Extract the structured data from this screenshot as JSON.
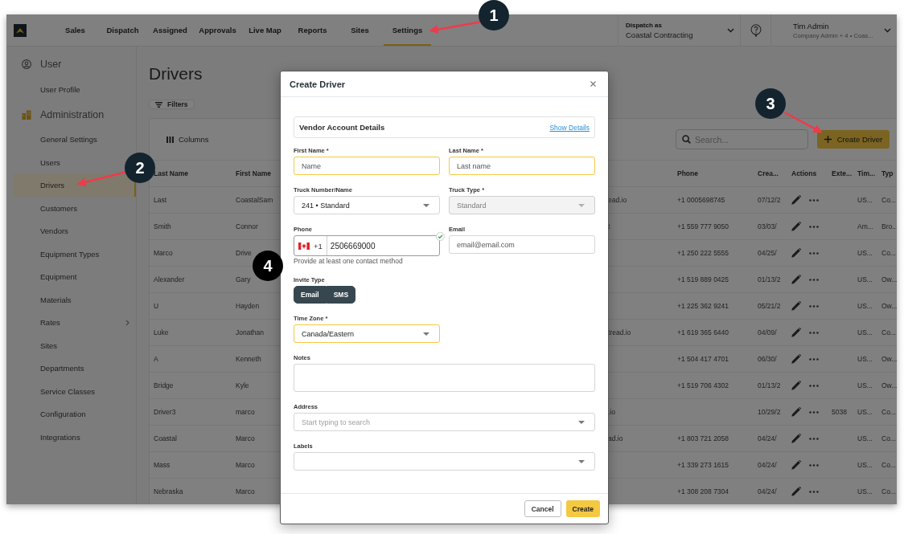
{
  "top_bar": {
    "nav": [
      {
        "label": "Sales",
        "selected": false
      },
      {
        "label": "Dispatch",
        "selected": false
      },
      {
        "label": "Assigned",
        "selected": false
      },
      {
        "label": "Approvals",
        "selected": false
      },
      {
        "label": "Live Map",
        "selected": false
      },
      {
        "label": "Reports",
        "selected": false
      },
      {
        "label": "Sites",
        "selected": false
      },
      {
        "label": "Settings",
        "selected": true
      }
    ],
    "dispatch_as": {
      "label": "Dispatch as",
      "value": "Coastal Contracting"
    },
    "user": {
      "name": "Tim Admin",
      "role": "Company Admin + 4 • Coas..."
    }
  },
  "sidebar": {
    "sections": [
      {
        "title": "User",
        "kind": "user",
        "items": [
          {
            "label": "User Profile",
            "selected": false,
            "has_submenu": false
          }
        ]
      },
      {
        "title": "Administration",
        "kind": "admin",
        "items": [
          {
            "label": "General Settings",
            "selected": false,
            "has_submenu": false
          },
          {
            "label": "Users",
            "selected": false,
            "has_submenu": false
          },
          {
            "label": "Drivers",
            "selected": true,
            "has_submenu": false
          },
          {
            "label": "Customers",
            "selected": false,
            "has_submenu": false
          },
          {
            "label": "Vendors",
            "selected": false,
            "has_submenu": false
          },
          {
            "label": "Equipment Types",
            "selected": false,
            "has_submenu": false
          },
          {
            "label": "Equipment",
            "selected": false,
            "has_submenu": false
          },
          {
            "label": "Materials",
            "selected": false,
            "has_submenu": false
          },
          {
            "label": "Rates",
            "selected": false,
            "has_submenu": true
          },
          {
            "label": "Sites",
            "selected": false,
            "has_submenu": false
          },
          {
            "label": "Departments",
            "selected": false,
            "has_submenu": false
          },
          {
            "label": "Service Classes",
            "selected": false,
            "has_submenu": false
          },
          {
            "label": "Configuration",
            "selected": false,
            "has_submenu": false
          },
          {
            "label": "Integrations",
            "selected": false,
            "has_submenu": false
          }
        ]
      }
    ]
  },
  "page": {
    "title": "Drivers",
    "filters_button": "Filters",
    "columns_button": "Columns",
    "search": {
      "placeholder": "Search..."
    },
    "create_button": "Create Driver"
  },
  "table": {
    "columns": [
      {
        "label": "Last Name",
        "kind": "text"
      },
      {
        "label": "First Name",
        "kind": "text"
      },
      {
        "kind": "text"
      },
      {
        "label": "Phone",
        "kind": "text"
      },
      {
        "label": "Crea...",
        "kind": "text"
      },
      {
        "label": "Actions",
        "kind": "actions"
      },
      {
        "label": "Exte...",
        "kind": "text"
      },
      {
        "label": "Tim...",
        "kind": "text"
      },
      {
        "label": "Typ",
        "kind": "text"
      }
    ],
    "rows": [
      {
        "cells": [
          "Last",
          "CoastalSam",
          "ead.io",
          "+1 0005698745",
          "07/12/2",
          null,
          null,
          "US...",
          "Co..."
        ]
      },
      {
        "cells": [
          "Smith",
          "Connor",
          "t",
          "+1 559 777 9050",
          "03/03/",
          null,
          null,
          "Am...",
          "Bro..."
        ]
      },
      {
        "cells": [
          "Marco",
          "Drive",
          null,
          "+1 250 222 5555",
          "04/25/",
          null,
          null,
          "US...",
          "Co..."
        ]
      },
      {
        "cells": [
          "Alexander",
          "Gary",
          null,
          "+1 519 889 0425",
          "01/13/2",
          null,
          null,
          "US...",
          "Ow..."
        ]
      },
      {
        "cells": [
          "U",
          "Hayden",
          null,
          "+1 225 362 9241",
          "05/21/2",
          null,
          null,
          "US...",
          "Ow..."
        ]
      },
      {
        "cells": [
          "Luke",
          "Jonathan",
          "tread.io",
          "+1 619 365 6440",
          "04/09/",
          null,
          null,
          "US...",
          "Co..."
        ]
      },
      {
        "cells": [
          "A",
          "Kenneth",
          null,
          "+1 504 417 4701",
          "06/30/",
          null,
          null,
          "US...",
          "Ow..."
        ]
      },
      {
        "cells": [
          "Bridge",
          "Kyle",
          null,
          "+1 519 706 4302",
          "01/13/2",
          null,
          null,
          "US...",
          "Ow..."
        ]
      },
      {
        "cells": [
          "Driver3",
          "marco",
          ".io",
          null,
          "10/29/2",
          null,
          "5038",
          "US...",
          "Co..."
        ]
      },
      {
        "cells": [
          "Coastal",
          "Marco",
          "ad.io",
          "+1 803 721 2058",
          "04/24/",
          null,
          null,
          "US...",
          "Co..."
        ]
      },
      {
        "cells": [
          "Mass",
          "Marco",
          null,
          "+1 339 273 1615",
          "04/24/",
          null,
          null,
          "US...",
          "Co..."
        ]
      },
      {
        "cells": [
          "Nebraska",
          "Marco",
          null,
          "+1 308 208 7304",
          "04/24/",
          null,
          null,
          "US...",
          "Co..."
        ]
      }
    ]
  },
  "dialog": {
    "title": "Create Driver",
    "account_card": {
      "title": "Vendor Account Details",
      "link": "Show Details"
    },
    "form_rows": [
      [
        {
          "kind": "text",
          "label": "First Name *",
          "placeholder": "Name",
          "highlighted": true,
          "disabled": false
        },
        {
          "kind": "text",
          "label": "Last Name *",
          "placeholder": "Last name",
          "highlighted": true,
          "disabled": false
        }
      ],
      [
        {
          "kind": "select",
          "label": "Truck Number/Name",
          "value": "241 • Standard",
          "highlighted": false,
          "disabled": false
        },
        {
          "kind": "select",
          "label": "Truck Type *",
          "value": "Standard",
          "highlighted": false,
          "disabled": true
        }
      ],
      [
        {
          "kind": "phone",
          "label": "Phone",
          "country_code": "+1",
          "value": "2506669000",
          "valid": true,
          "helper": "Provide at least one contact method",
          "highlighted": false,
          "disabled": false
        },
        {
          "kind": "text",
          "label": "Email",
          "placeholder": "email@email.com",
          "highlighted": false,
          "disabled": false
        }
      ],
      [
        {
          "kind": "toggle",
          "label": "Invite Type",
          "options": [
            {
              "label": "Email",
              "selected": true
            },
            {
              "label": "SMS",
              "selected": true
            }
          ]
        }
      ],
      [
        {
          "kind": "select",
          "label": "Time Zone *",
          "value": "Canada/Eastern",
          "highlighted": true,
          "disabled": false
        }
      ],
      [
        {
          "kind": "textarea",
          "label": "Notes",
          "highlighted": false,
          "disabled": false
        }
      ],
      [
        {
          "kind": "autocomplete",
          "label": "Address",
          "placeholder": "Start typing to search",
          "highlighted": false,
          "disabled": false
        }
      ],
      [
        {
          "kind": "multiselect",
          "label": "Labels",
          "highlighted": false,
          "disabled": false
        }
      ]
    ],
    "buttons": [
      {
        "label": "Cancel",
        "kind": "secondary"
      },
      {
        "label": "Create",
        "kind": "primary"
      }
    ]
  },
  "callouts": [
    {
      "number": "1",
      "arrow": true,
      "color": "#13242f"
    },
    {
      "number": "2",
      "arrow": true,
      "color": "#13242f"
    },
    {
      "number": "3",
      "arrow": true,
      "color": "#13242f"
    },
    {
      "number": "4",
      "arrow": false,
      "color": "#000000"
    }
  ]
}
